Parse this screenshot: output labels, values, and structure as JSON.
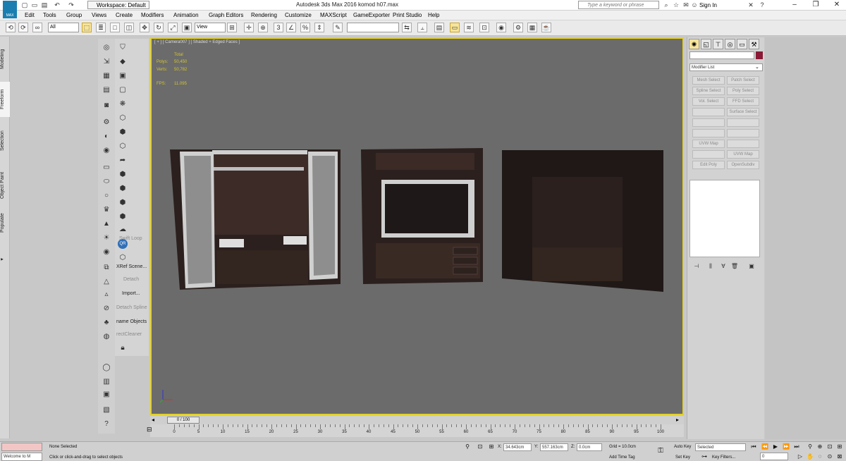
{
  "title_bar": {
    "workspace": "Workspace: Default",
    "title": "Autodesk 3ds Max 2016     komod h07.max",
    "search_placeholder": "Type a keyword or phrase",
    "sign_in": "Sign In"
  },
  "app_logo": "MAX",
  "menu": [
    "Edit",
    "Tools",
    "Group",
    "Views",
    "Create",
    "Modifiers",
    "Animation",
    "Graph Editors",
    "Rendering",
    "Customize",
    "MAXScript",
    "GameExporter",
    "Print Studio",
    "Help"
  ],
  "toolbar": {
    "selection_filter": "All",
    "ref_coord": "View",
    "named_selection": ""
  },
  "ribbon_tabs": [
    "Modeling",
    "Freeform",
    "Selection",
    "Object Paint",
    "Populate"
  ],
  "tool_panel": {
    "items": [
      {
        "label": "Swift Loop",
        "enabled": false
      },
      {
        "label": "XRef Scene...",
        "enabled": true
      },
      {
        "label": "Detach",
        "enabled": false
      },
      {
        "label": "Import...",
        "enabled": true
      },
      {
        "label": "Detach Spline",
        "enabled": false
      },
      {
        "label": "name Objects",
        "enabled": true
      },
      {
        "label": "rectCleaner",
        "enabled": false
      }
    ]
  },
  "viewport": {
    "label": "[ + ] [ Camera007 ] [ Shaded + Edged Faces ]",
    "stats": {
      "total_label": "Total",
      "polys_label": "Polys:",
      "polys": "50,450",
      "verts_label": "Verts:",
      "verts": "50,782",
      "fps_label": "FPS:",
      "fps": "11.095"
    },
    "colors": {
      "bg": "#6b6b6b",
      "border": "#e3d12a",
      "wood": "#2e2220",
      "glass": "#7a7a7a"
    }
  },
  "command_panel": {
    "name_field": "",
    "modifier_list": "Modifier List",
    "buttons": [
      [
        "Mesh Select",
        "Patch Select"
      ],
      [
        "Spline Select",
        "Poly Select"
      ],
      [
        "Vol. Select",
        "FFD Select"
      ],
      [
        "",
        "Surface Select"
      ],
      [
        "",
        ""
      ],
      [
        "",
        ""
      ],
      [
        "UVW Map",
        ""
      ],
      [
        "",
        "UVW Map"
      ],
      [
        "Edit Poly",
        "OpenSubdiv"
      ]
    ]
  },
  "timeline": {
    "slider_label": "0 / 100",
    "ticks": [
      "0",
      "5",
      "10",
      "15",
      "20",
      "25",
      "30",
      "35",
      "40",
      "45",
      "50",
      "55",
      "60",
      "65",
      "70",
      "75",
      "80",
      "85",
      "90",
      "95",
      "100"
    ],
    "current_frame": 0,
    "total_frames": 100
  },
  "status": {
    "maxscript_listener": "Welcome to M",
    "selection": "None Selected",
    "prompt": "Click or click-and-drag to select objects",
    "x_label": "X:",
    "x": "34.643cm",
    "y_label": "Y:",
    "y": "557.163cm",
    "z_label": "Z:",
    "z": "0.0cm",
    "grid": "Grid = 10.0cm",
    "add_time_tag": "Add Time Tag",
    "auto_key": "Auto Key",
    "set_key": "Set Key",
    "selected_dropdown": "Selected",
    "key_filters": "Key Filters...",
    "frame_field": "0"
  }
}
